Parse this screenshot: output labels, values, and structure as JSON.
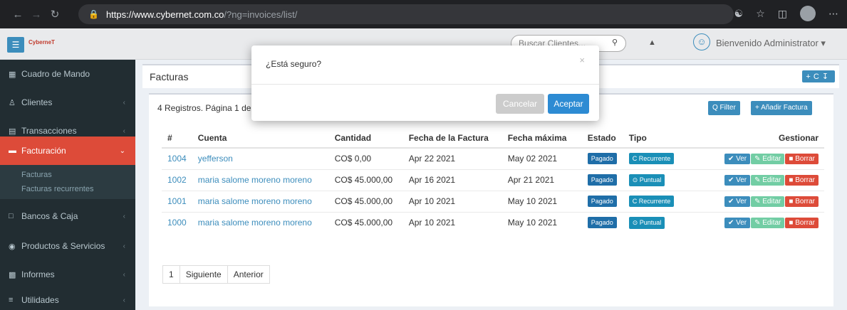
{
  "browser": {
    "url_host": "https://www.cybernet.com.co",
    "url_path": "/?ng=invoices/list/"
  },
  "topbar": {
    "logo_text": "CyberneT",
    "search_placeholder": "Buscar Clientes...",
    "welcome": "Bienvenido Administrator ▾"
  },
  "sidebar": {
    "items": [
      {
        "label": "Cuadro de Mando",
        "icon": "dashboard-icon"
      },
      {
        "label": "Clientes",
        "icon": "users-icon"
      },
      {
        "label": "Transacciones",
        "icon": "transactions-icon"
      },
      {
        "label": "Facturación",
        "icon": "billing-icon"
      },
      {
        "label": "Bancos & Caja",
        "icon": "bank-icon"
      },
      {
        "label": "Productos & Servicios",
        "icon": "products-icon"
      },
      {
        "label": "Informes",
        "icon": "reports-icon"
      },
      {
        "label": "Utilidades",
        "icon": "utilities-icon"
      }
    ],
    "submenu": [
      "Facturas",
      "Facturas recurrentes"
    ]
  },
  "page": {
    "title": "Facturas",
    "records_info": "4 Registros. Página 1 de",
    "filter_label": "Q Filter",
    "add_label": "+ Añadir Factura"
  },
  "table": {
    "headers": [
      "#",
      "Cuenta",
      "Cantidad",
      "Fecha de la Factura",
      "Fecha máxima",
      "Estado",
      "Tipo",
      "Gestionar"
    ],
    "rows": [
      {
        "id": "1004",
        "cuenta": "yefferson",
        "cantidad": "CO$ 0,00",
        "fecha": "Apr 22 2021",
        "maxima": "May 02 2021",
        "estado": "Pagado",
        "tipo": "C Recurrente"
      },
      {
        "id": "1002",
        "cuenta": "maria salome moreno moreno",
        "cantidad": "CO$ 45.000,00",
        "fecha": "Apr 16 2021",
        "maxima": "Apr 21 2021",
        "estado": "Pagado",
        "tipo": "⊙ Puntual"
      },
      {
        "id": "1001",
        "cuenta": "maria salome moreno moreno",
        "cantidad": "CO$ 45.000,00",
        "fecha": "Apr 10 2021",
        "maxima": "May 10 2021",
        "estado": "Pagado",
        "tipo": "C Recurrente"
      },
      {
        "id": "1000",
        "cuenta": "maria salome moreno moreno",
        "cantidad": "CO$ 45.000,00",
        "fecha": "Apr 10 2021",
        "maxima": "May 10 2021",
        "estado": "Pagado",
        "tipo": "⊙ Puntual"
      }
    ],
    "actions": {
      "ver": "✔ Ver",
      "editar": "✎ Editar",
      "borrar": "■ Borrar"
    }
  },
  "pager": [
    "1",
    "Siguiente",
    "Anterior"
  ],
  "modal": {
    "title": "¿Está seguro?",
    "close": "×",
    "cancel": "Cancelar",
    "accept": "Aceptar"
  }
}
